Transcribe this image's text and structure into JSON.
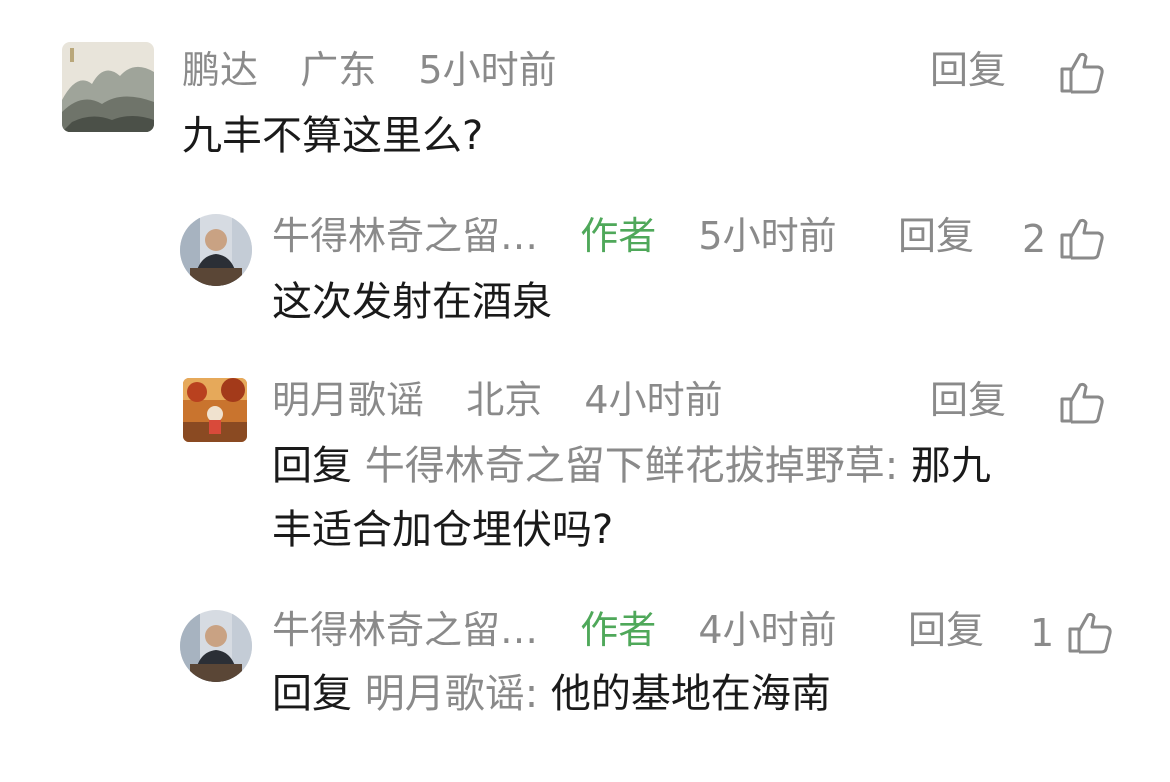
{
  "comments": [
    {
      "author": "鹏达",
      "location": "广东",
      "time": "5小时前",
      "reply_label": "回复",
      "like_count": "",
      "text": "九丰不算这里么?",
      "avatar": "landscape-painting"
    },
    {
      "author": "牛得林奇之留…",
      "tag": "作者",
      "time": "5小时前",
      "reply_label": "回复",
      "like_count": "2",
      "text": "这次发射在酒泉",
      "avatar": "man-at-desk"
    },
    {
      "author": "明月歌谣",
      "location": "北京",
      "time": "4小时前",
      "reply_label": "回复",
      "like_count": "",
      "reply_prefix": "回复",
      "reply_target": "牛得林奇之留下鲜花拔掉野草:",
      "text": "那九",
      "text_line2": "丰适合加仓埋伏吗?",
      "avatar": "autumn-scene"
    },
    {
      "author": "牛得林奇之留…",
      "tag": "作者",
      "time": "4小时前",
      "reply_label": "回复",
      "like_count": "1",
      "reply_prefix": "回复",
      "reply_target": "明月歌谣:",
      "text": "他的基地在海南",
      "avatar": "man-at-desk"
    }
  ],
  "colors": {
    "meta_gray": "#8a8a8a",
    "author_tag_green": "#4fa85a",
    "text_dark": "#1a1a1a"
  },
  "icons": {
    "like": "thumbs-up-icon"
  }
}
